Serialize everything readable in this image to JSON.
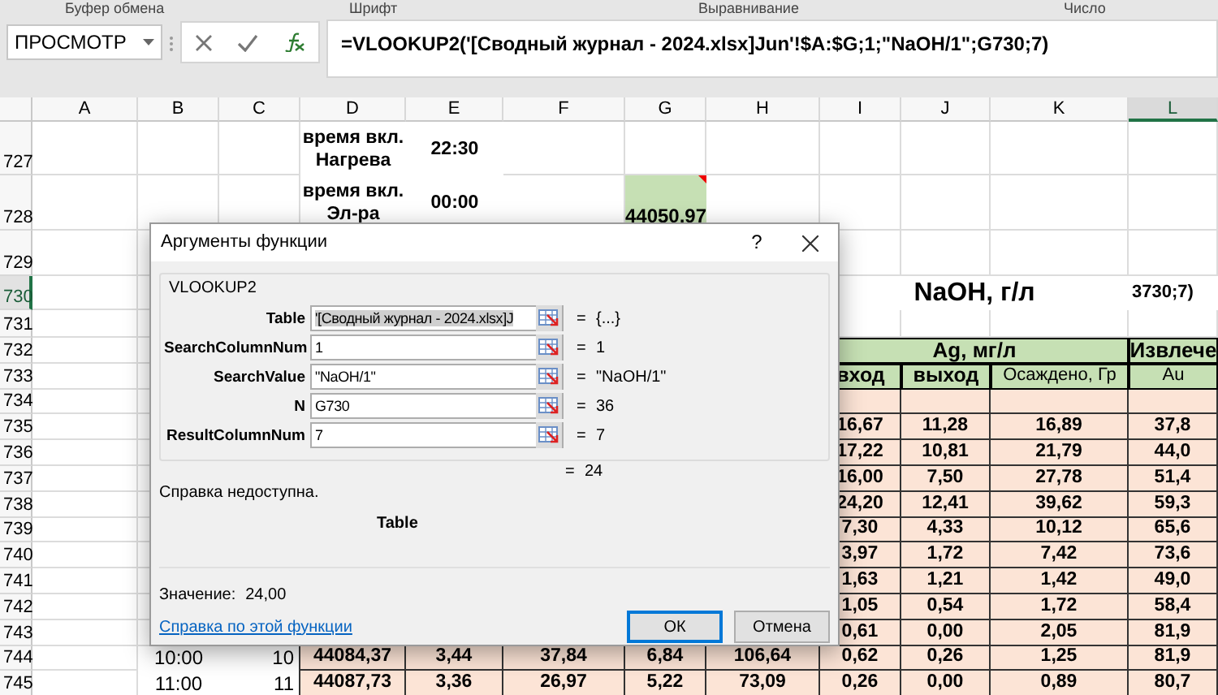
{
  "ribbon_groups": [
    "Буфер обмена",
    "Шрифт",
    "Выравнивание",
    "Число"
  ],
  "name_box": "ПРОСМОТР",
  "formula": "=VLOOKUP2('[Сводный журнал - 2024.xlsx]Jun'!$A:$G;1;\"NaOH/1\";G730;7)",
  "columns": [
    {
      "label": "A",
      "selected": false
    },
    {
      "label": "B",
      "selected": false
    },
    {
      "label": "C",
      "selected": false
    },
    {
      "label": "D",
      "selected": false
    },
    {
      "label": "E",
      "selected": false
    },
    {
      "label": "F",
      "selected": false
    },
    {
      "label": "G",
      "selected": false
    },
    {
      "label": "H",
      "selected": false
    },
    {
      "label": "I",
      "selected": false
    },
    {
      "label": "J",
      "selected": false
    },
    {
      "label": "K",
      "selected": false
    },
    {
      "label": "L",
      "selected": true
    }
  ],
  "rows": [
    {
      "number": "727",
      "selected": false,
      "cells": {
        "D": {
          "kind": "label",
          "text": "время вкл. Нагрева"
        },
        "E": {
          "kind": "label",
          "text": "22:30"
        }
      }
    },
    {
      "number": "728",
      "selected": false,
      "cells": {
        "D": {
          "kind": "label",
          "text": "время вкл. Эл-ра"
        },
        "E": {
          "kind": "label",
          "text": "00:00"
        },
        "G": {
          "kind": "highlight",
          "text": "44050,97"
        }
      }
    },
    {
      "number": "729",
      "selected": false,
      "cells": {}
    },
    {
      "number": "730",
      "selected": true,
      "cells": {
        "I": {
          "kind": "title",
          "text": "NaOH, г/л"
        },
        "L": {
          "kind": "edit",
          "text": "3730;7)"
        }
      }
    },
    {
      "number": "731",
      "selected": false,
      "cells": {}
    },
    {
      "number": "732",
      "selected": false,
      "cells": {
        "I": {
          "kind": "merged_group",
          "text": "Ag, мг/л"
        },
        "L": {
          "kind": "group",
          "text": "Извлече"
        }
      }
    },
    {
      "number": "733",
      "selected": false,
      "cells": {
        "I": {
          "kind": "subheader",
          "text": "вход"
        },
        "J": {
          "kind": "subheader",
          "text": "выход"
        },
        "K": {
          "kind": "subnote",
          "text": "Осаждено, Гр"
        },
        "L": {
          "kind": "subnote",
          "text": "Au"
        }
      }
    },
    {
      "number": "734",
      "selected": false,
      "cells": {
        "I": {
          "kind": "data"
        },
        "J": {
          "kind": "data"
        },
        "K": {
          "kind": "data"
        },
        "L": {
          "kind": "data"
        }
      }
    },
    {
      "number": "735",
      "selected": false,
      "cells": {
        "I": {
          "kind": "data",
          "text": "16,67"
        },
        "J": {
          "kind": "data",
          "text": "11,28"
        },
        "K": {
          "kind": "data",
          "text": "16,89"
        },
        "L": {
          "kind": "data",
          "text": "37,8"
        }
      }
    },
    {
      "number": "736",
      "selected": false,
      "cells": {
        "I": {
          "kind": "data",
          "text": "17,22"
        },
        "J": {
          "kind": "data",
          "text": "10,81"
        },
        "K": {
          "kind": "data",
          "text": "21,79"
        },
        "L": {
          "kind": "data",
          "text": "44,0"
        }
      }
    },
    {
      "number": "737",
      "selected": false,
      "cells": {
        "I": {
          "kind": "data",
          "text": "16,00"
        },
        "J": {
          "kind": "data",
          "text": "7,50"
        },
        "K": {
          "kind": "data",
          "text": "27,78"
        },
        "L": {
          "kind": "data",
          "text": "51,4"
        }
      }
    },
    {
      "number": "738",
      "selected": false,
      "cells": {
        "I": {
          "kind": "data",
          "text": "24,20"
        },
        "J": {
          "kind": "data",
          "text": "12,41"
        },
        "K": {
          "kind": "data",
          "text": "39,62"
        },
        "L": {
          "kind": "data",
          "text": "59,3"
        }
      }
    },
    {
      "number": "739",
      "selected": false,
      "cells": {
        "I": {
          "kind": "data",
          "text": "7,30"
        },
        "J": {
          "kind": "data",
          "text": "4,33"
        },
        "K": {
          "kind": "data",
          "text": "10,12"
        },
        "L": {
          "kind": "data",
          "text": "65,6"
        }
      }
    },
    {
      "number": "740",
      "selected": false,
      "cells": {
        "I": {
          "kind": "data",
          "text": "3,97"
        },
        "J": {
          "kind": "data",
          "text": "1,72"
        },
        "K": {
          "kind": "data",
          "text": "7,42"
        },
        "L": {
          "kind": "data",
          "text": "73,6"
        }
      }
    },
    {
      "number": "741",
      "selected": false,
      "cells": {
        "I": {
          "kind": "data",
          "text": "1,63"
        },
        "J": {
          "kind": "data",
          "text": "1,21"
        },
        "K": {
          "kind": "data",
          "text": "1,42"
        },
        "L": {
          "kind": "data",
          "text": "49,0"
        }
      }
    },
    {
      "number": "742",
      "selected": false,
      "cells": {
        "I": {
          "kind": "data",
          "text": "1,05"
        },
        "J": {
          "kind": "data",
          "text": "0,54"
        },
        "K": {
          "kind": "data",
          "text": "1,72"
        },
        "L": {
          "kind": "data",
          "text": "58,4"
        }
      }
    },
    {
      "number": "743",
      "selected": false,
      "cells": {
        "I": {
          "kind": "data",
          "text": "0,61"
        },
        "J": {
          "kind": "data",
          "text": "0,00"
        },
        "K": {
          "kind": "data",
          "text": "2,05"
        },
        "L": {
          "kind": "data",
          "text": "81,9"
        }
      }
    },
    {
      "number": "744",
      "selected": false,
      "cells": {
        "B": {
          "kind": "time",
          "text": "10:00"
        },
        "C": {
          "kind": "number",
          "text": "10"
        },
        "D": {
          "kind": "data",
          "text": "44084,37"
        },
        "E": {
          "kind": "data",
          "text": "3,44"
        },
        "F": {
          "kind": "data",
          "text": "37,84"
        },
        "G": {
          "kind": "data",
          "text": "6,84"
        },
        "H": {
          "kind": "data",
          "text": "106,64"
        },
        "I": {
          "kind": "data",
          "text": "0,62"
        },
        "J": {
          "kind": "data",
          "text": "0,26"
        },
        "K": {
          "kind": "data",
          "text": "1,25"
        },
        "L": {
          "kind": "data",
          "text": "81,9"
        }
      }
    },
    {
      "number": "745",
      "selected": false,
      "cells": {
        "B": {
          "kind": "time",
          "text": "11:00"
        },
        "C": {
          "kind": "number",
          "text": "11"
        },
        "D": {
          "kind": "data",
          "text": "44087,73"
        },
        "E": {
          "kind": "data",
          "text": "3,36"
        },
        "F": {
          "kind": "data",
          "text": "26,97"
        },
        "G": {
          "kind": "data",
          "text": "5,22"
        },
        "H": {
          "kind": "data",
          "text": "73,09"
        },
        "I": {
          "kind": "data",
          "text": "0,26"
        },
        "J": {
          "kind": "data",
          "text": "0,00"
        },
        "K": {
          "kind": "data",
          "text": "0,89"
        },
        "L": {
          "kind": "data",
          "text": "80,7"
        }
      }
    }
  ],
  "dialog": {
    "title": "Аргументы функции",
    "help_mark": "?",
    "function_name": "VLOOKUP2",
    "args": [
      {
        "label": "Table",
        "value": "'[Сводный журнал - 2024.xlsx]J",
        "text_selected": true,
        "sign": "=",
        "result": "{...}"
      },
      {
        "label": "SearchColumnNum",
        "value": "1",
        "text_selected": false,
        "sign": "=",
        "result": "1"
      },
      {
        "label": "SearchValue",
        "value": "\"NaOH/1\"",
        "text_selected": false,
        "sign": "=",
        "result": "\"NaOH/1\""
      },
      {
        "label": "N",
        "value": "G730",
        "text_selected": false,
        "sign": "=",
        "result": "36"
      },
      {
        "label": "ResultColumnNum",
        "value": "7",
        "text_selected": false,
        "sign": "=",
        "result": "7"
      }
    ],
    "total_sign": "=",
    "total_result": "24",
    "help_text": "Справка недоступна.",
    "arg_name": "Table",
    "value_label": "Значение:",
    "value": "24,00",
    "help_link": "Справка по этой функции",
    "buttons": [
      {
        "label": "ОК",
        "default": true
      },
      {
        "label": "Отмена",
        "default": false
      }
    ]
  }
}
